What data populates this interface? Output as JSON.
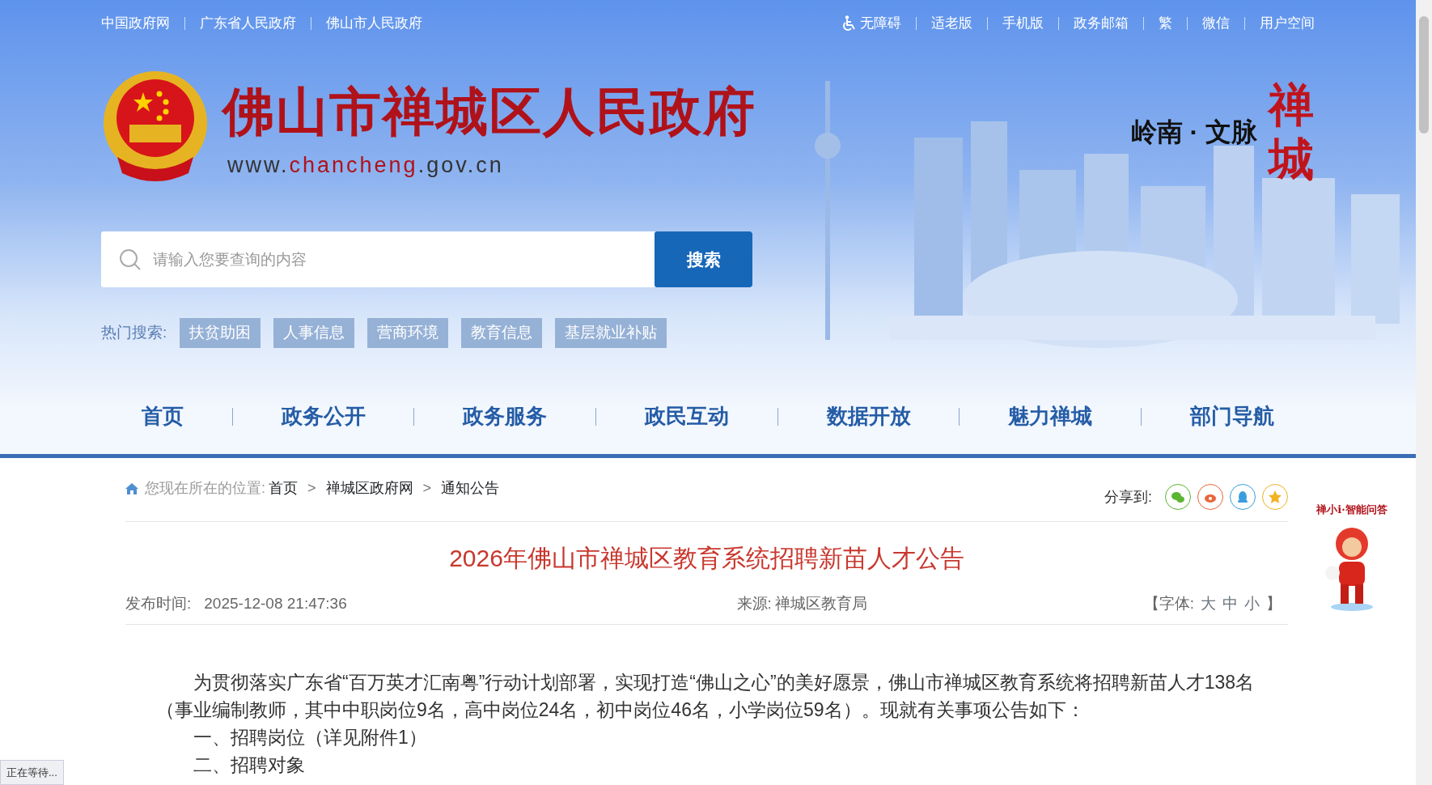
{
  "top_links_left": [
    "中国政府网",
    "广东省人民政府",
    "佛山市人民政府"
  ],
  "top_links_right": [
    {
      "label": "无障碍",
      "kind": "accessibility"
    },
    {
      "label": "适老版",
      "kind": "text"
    },
    {
      "label": "手机版",
      "kind": "text"
    },
    {
      "label": "政务邮箱",
      "kind": "text"
    },
    {
      "label": "繁",
      "kind": "text"
    },
    {
      "label": "微信",
      "kind": "text"
    },
    {
      "label": "用户空间",
      "kind": "text"
    }
  ],
  "site": {
    "name": "佛山市禅城区人民政府",
    "url": {
      "prefix": "www.",
      "highlight": "chancheng",
      "suffix": ".gov.cn"
    },
    "slogan": "岭南 · 文脉",
    "calligraphy": "禅城"
  },
  "search": {
    "placeholder": "请输入您要查询的内容",
    "button": "搜索"
  },
  "hot_search": {
    "label": "热门搜索:",
    "tags": [
      "扶贫助困",
      "人事信息",
      "营商环境",
      "教育信息",
      "基层就业补贴"
    ]
  },
  "nav": [
    "首页",
    "政务公开",
    "政务服务",
    "政民互动",
    "数据开放",
    "魅力禅城",
    "部门导航"
  ],
  "breadcrumb": {
    "label": "您现在所在的位置:",
    "separator": ">",
    "items": [
      "首页",
      "禅城区政府网",
      "通知公告"
    ]
  },
  "share": {
    "label": "分享到:",
    "targets": [
      {
        "kind": "wechat",
        "color": "#5cb531"
      },
      {
        "kind": "weibo",
        "color": "#e8663a"
      },
      {
        "kind": "qq",
        "color": "#3a9ede"
      },
      {
        "kind": "favorite",
        "color": "#f0b323"
      }
    ]
  },
  "article": {
    "title": "2026年佛山市禅城区教育系统招聘新苗人才公告",
    "published_label": "发布时间:",
    "published": "2025-12-08 21:47:36",
    "source_label": "来源:",
    "source": "禅城区教育局",
    "font_size": {
      "open": "【字体:",
      "options": [
        "大",
        "中",
        "小"
      ],
      "close": "】"
    },
    "paragraphs": [
      "为贯彻落实广东省“百万英才汇南粤”行动计划部署，实现打造“佛山之心”的美好愿景，佛山市禅城区教育系统将招聘新苗人才138名（事业编制教师，其中中职岗位9名，高中岗位24名，初中岗位46名，小学岗位59名）。现就有关事项公告如下：",
      "一、招聘岗位（详见附件1）",
      "二、招聘对象"
    ]
  },
  "assistant": {
    "label": "禅小i·智能问答"
  },
  "status_bar": "正在等待..."
}
